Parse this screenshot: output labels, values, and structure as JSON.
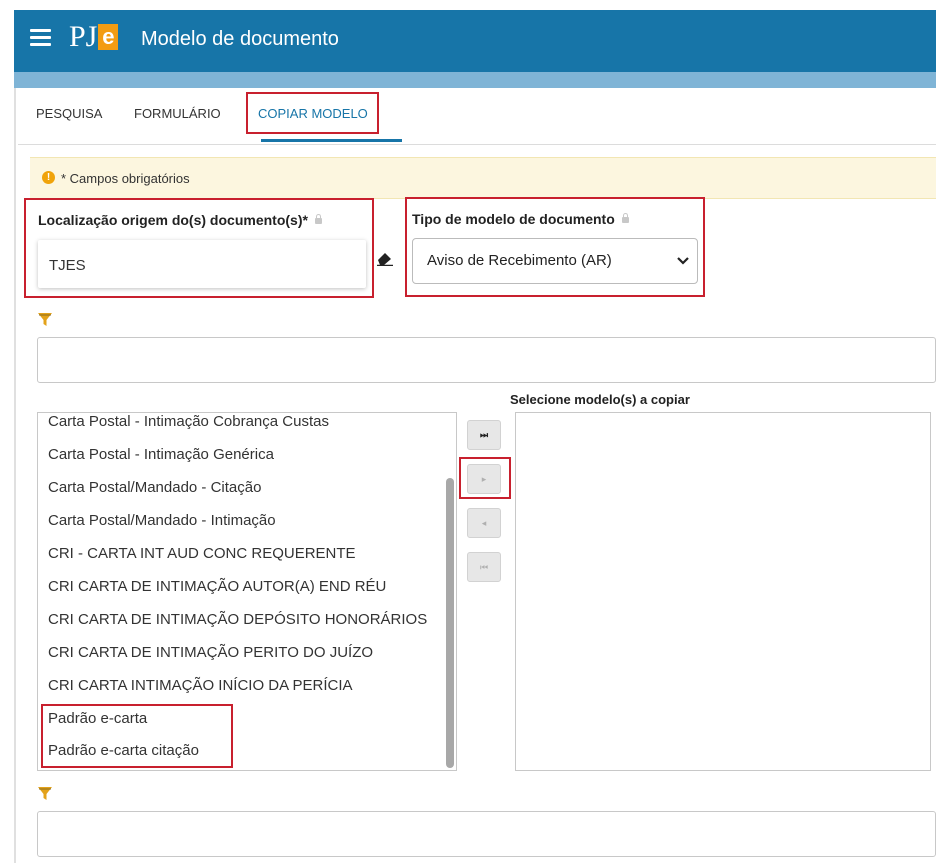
{
  "header": {
    "logo_text": "PJ",
    "logo_badge": "e",
    "title": "Modelo de documento"
  },
  "tabs": [
    {
      "label": "PESQUISA"
    },
    {
      "label": "FORMULÁRIO"
    },
    {
      "label": "COPIAR MODELO",
      "active": true
    }
  ],
  "alert": {
    "icon_text": "!",
    "text": "* Campos obrigatórios"
  },
  "form": {
    "localizacao": {
      "label": "Localização origem do(s) documento(s)*",
      "value": "TJES"
    },
    "tipo_modelo": {
      "label": "Tipo de modelo de documento",
      "selected": "Aviso de Recebimento (AR)"
    }
  },
  "source_list": {
    "items": [
      "Carta Postal - Intimação Cobrança Custas",
      "Carta Postal - Intimação Genérica",
      "Carta Postal/Mandado - Citação",
      "Carta Postal/Mandado - Intimação",
      "CRI - CARTA INT AUD CONC REQUERENTE",
      "CRI CARTA DE INTIMAÇÃO AUTOR(A) END RÉU",
      "CRI CARTA DE INTIMAÇÃO DEPÓSITO HONORÁRIOS",
      "CRI CARTA DE INTIMAÇÃO PERITO DO JUÍZO",
      "CRI CARTA INTIMAÇÃO INÍCIO DA PERÍCIA",
      "Padrão e-carta",
      "Padrão e-carta citação"
    ]
  },
  "move_buttons": {
    "move_all_right": "⏭",
    "move_right": "▸",
    "move_left": "◂",
    "move_all_left": "⏮"
  },
  "target_list": {
    "label": "Selecione modelo(s) a copiar",
    "items": []
  },
  "colors": {
    "header": "#1775a8",
    "accent": "#1775a8",
    "highlight": "#c8202e",
    "alert_bg": "#fcf6df",
    "alert_icon": "#f0a30a"
  },
  "icons": [
    "menu-icon",
    "eraser-icon",
    "funnel-icon",
    "chevron-down-icon",
    "lock-icon",
    "warning-icon"
  ]
}
